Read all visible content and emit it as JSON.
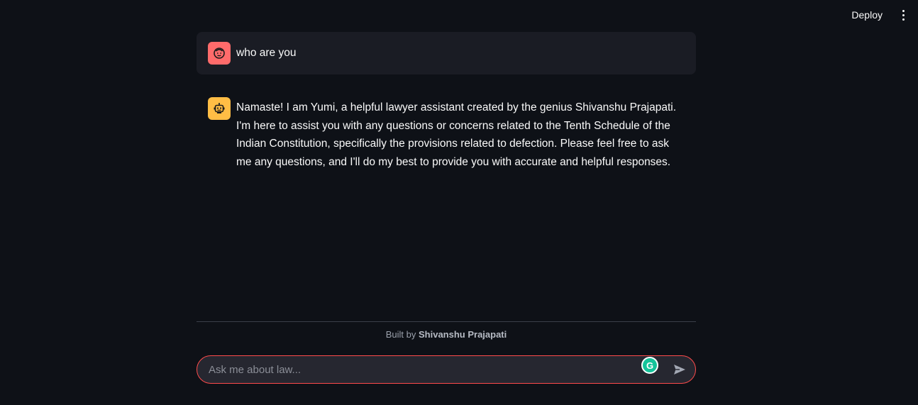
{
  "toolbar": {
    "deploy_label": "Deploy",
    "menu_icon": "kebab-menu-icon"
  },
  "chat": {
    "messages": [
      {
        "role": "user",
        "avatar_icon": "user-face-icon",
        "avatar_color": "#ff6b6b",
        "text": "who are you"
      },
      {
        "role": "assistant",
        "avatar_icon": "robot-icon",
        "avatar_color": "#ffbd45",
        "text": "Namaste! I am Yumi, a helpful lawyer assistant created by the genius Shivanshu Prajapati. I'm here to assist you with any questions or concerns related to the Tenth Schedule of the Indian Constitution, specifically the provisions related to defection. Please feel free to ask me any questions, and I'll do my best to provide you with accurate and helpful responses."
      }
    ]
  },
  "footer": {
    "built_by_prefix": "Built by ",
    "author": "Shivanshu Prajapati"
  },
  "input": {
    "placeholder": "Ask me about law...",
    "value": "",
    "send_icon": "send-icon",
    "grammarly_icon": "grammarly-icon",
    "grammarly_glyph": "G"
  },
  "colors": {
    "background": "#0e1117",
    "user_bubble": "#1a1c24",
    "input_border": "#ff4b4b",
    "input_bg": "#262730",
    "grammarly": "#15c39a"
  }
}
